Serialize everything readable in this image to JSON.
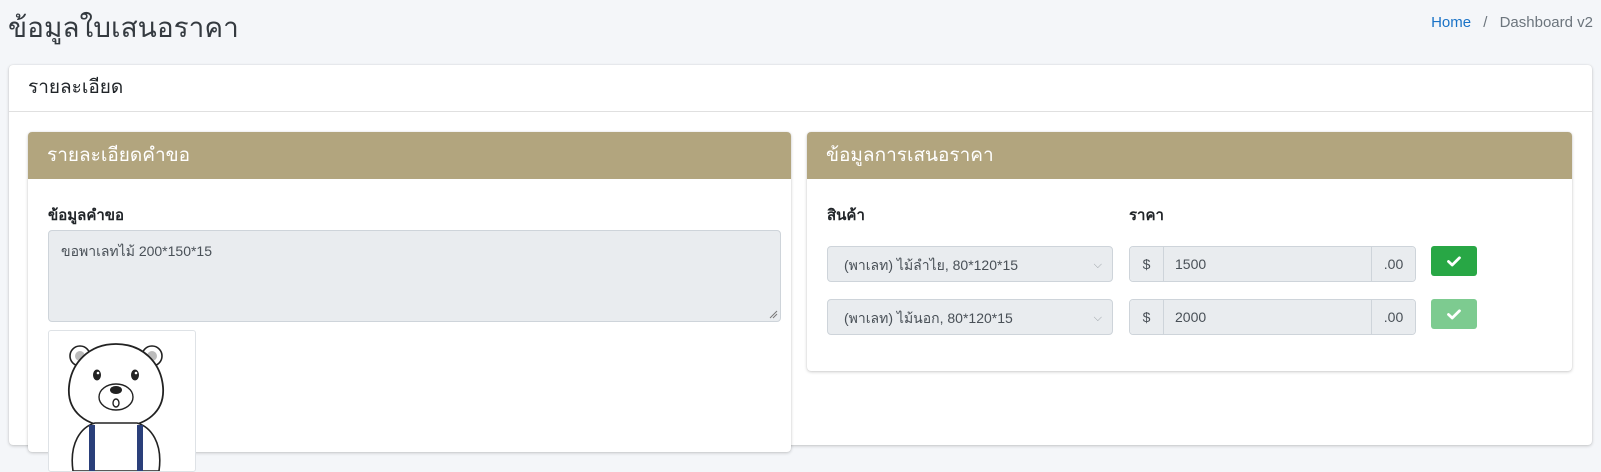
{
  "page": {
    "title": "ข้อมูลใบเสนอราคา"
  },
  "breadcrumb": {
    "home": "Home",
    "separator": "/",
    "current": "Dashboard v2"
  },
  "card": {
    "header": "รายละเอียด"
  },
  "request_panel": {
    "header": "รายละเอียดคำขอ",
    "field_label": "ข้อมูลคำขอ",
    "textarea_value": "ขอพาเลทไม้ 200*150*15",
    "image_icon": "bear-cartoon-image"
  },
  "quote_panel": {
    "header": "ข้อมูลการเสนอราคา",
    "product_label": "สินค้า",
    "price_label": "ราคา",
    "rows": [
      {
        "product": "(พาเลท) ไม้ลำไย, 80*120*15",
        "currency": "$",
        "price": "1500",
        "decimal": ".00",
        "confirm_enabled": true
      },
      {
        "product": "(พาเลท) ไม้นอก, 80*120*15",
        "currency": "$",
        "price": "2000",
        "decimal": ".00",
        "confirm_enabled": false
      }
    ]
  },
  "colors": {
    "panel_header": "#b2a57e",
    "button_success": "#28a745",
    "button_success_disabled": "#7dcb90",
    "link": "#1a73c7",
    "background": "#f4f6f9"
  }
}
